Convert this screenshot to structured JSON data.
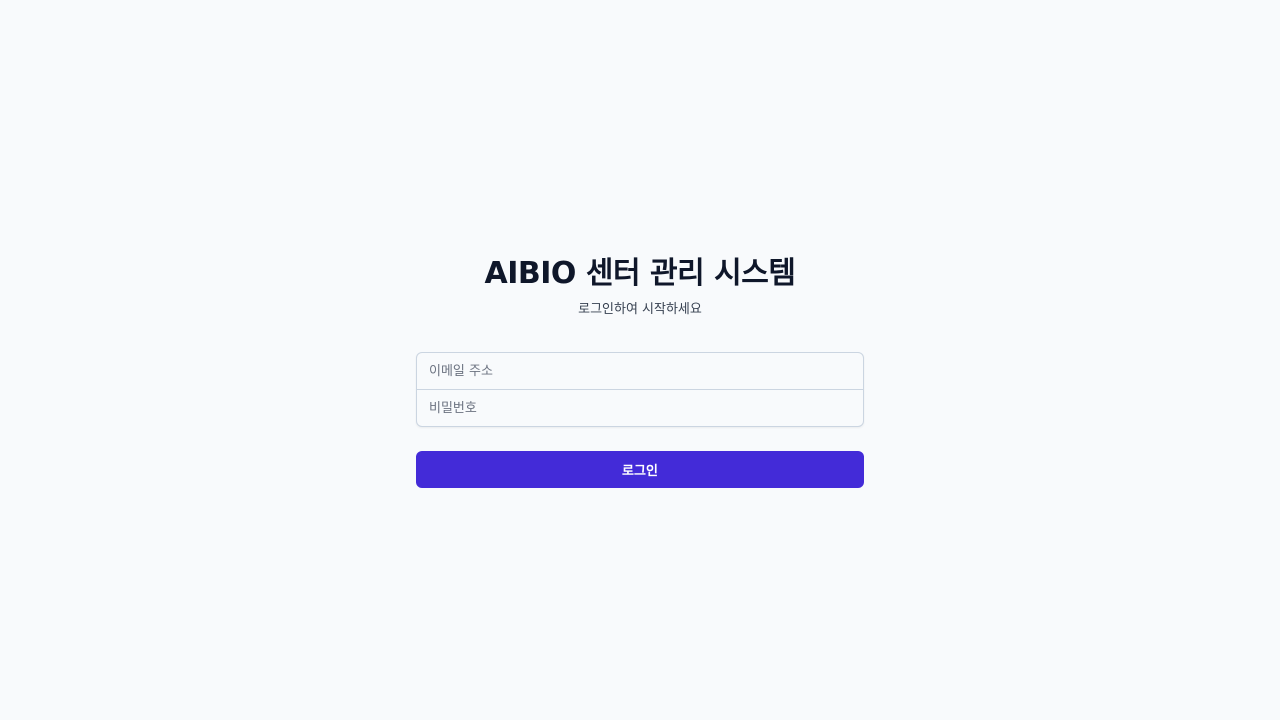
{
  "login": {
    "title": "AIBIO 센터 관리 시스템",
    "subtitle": "로그인하여 시작하세요",
    "email_placeholder": "이메일 주소",
    "email_value": "",
    "password_placeholder": "비밀번호",
    "password_value": "",
    "submit_label": "로그인"
  },
  "colors": {
    "background": "#f8fafc",
    "title": "#0f172a",
    "primary": "#432bd8",
    "border": "#cbd5e1"
  }
}
